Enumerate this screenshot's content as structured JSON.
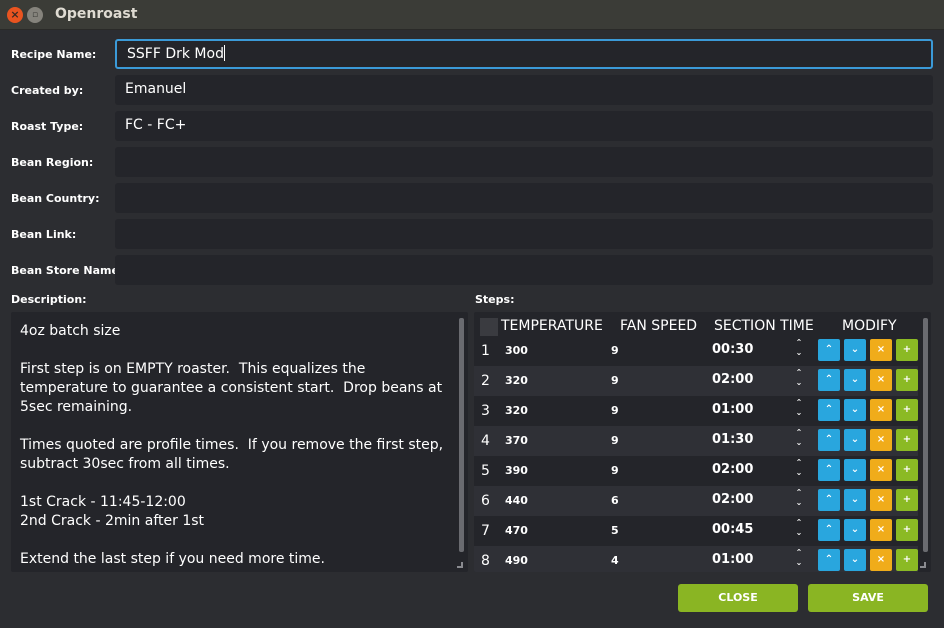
{
  "window": {
    "title": "Openroast",
    "close_glyph": "×",
    "max_glyph": "▫"
  },
  "form": {
    "recipe_name": {
      "label": "Recipe Name:",
      "value": "SSFF Drk Mod"
    },
    "created_by": {
      "label": "Created by:",
      "value": "Emanuel"
    },
    "roast_type": {
      "label": "Roast Type:",
      "value": "FC - FC+"
    },
    "bean_region": {
      "label": "Bean Region:",
      "value": ""
    },
    "bean_country": {
      "label": "Bean Country:",
      "value": ""
    },
    "bean_link": {
      "label": "Bean Link:",
      "value": ""
    },
    "bean_store_name": {
      "label": "Bean Store Name:",
      "value": ""
    }
  },
  "description": {
    "label": "Description:",
    "text": "4oz batch size\n\nFirst step is on EMPTY roaster.  This equalizes the temperature to guarantee a consistent start.  Drop beans at 5sec remaining.\n\nTimes quoted are profile times.  If you remove the first step, subtract 30sec from all times.\n\n1st Crack - 11:45-12:00\n2nd Crack - 2min after 1st\n\nExtend the last step if you need more time."
  },
  "steps": {
    "label": "Steps:",
    "columns": {
      "temperature": "TEMPERATURE",
      "fan_speed": "FAN SPEED",
      "section_time": "SECTION TIME",
      "modify": "MODIFY"
    },
    "spin_up": "⌃",
    "spin_down": "⌄",
    "buttons": {
      "up": "⌃",
      "down": "⌄",
      "delete": "×",
      "add": "+"
    },
    "rows": [
      {
        "num": "1",
        "temperature": "300",
        "fan_speed": "9",
        "time": "00:30"
      },
      {
        "num": "2",
        "temperature": "320",
        "fan_speed": "9",
        "time": "02:00"
      },
      {
        "num": "3",
        "temperature": "320",
        "fan_speed": "9",
        "time": "01:00"
      },
      {
        "num": "4",
        "temperature": "370",
        "fan_speed": "9",
        "time": "01:30"
      },
      {
        "num": "5",
        "temperature": "390",
        "fan_speed": "9",
        "time": "02:00"
      },
      {
        "num": "6",
        "temperature": "440",
        "fan_speed": "6",
        "time": "02:00"
      },
      {
        "num": "7",
        "temperature": "470",
        "fan_speed": "5",
        "time": "00:45"
      },
      {
        "num": "8",
        "temperature": "490",
        "fan_speed": "4",
        "time": "01:00"
      }
    ]
  },
  "footer": {
    "close_label": "CLOSE",
    "save_label": "SAVE"
  },
  "colors": {
    "accent_green": "#8ab523",
    "blue": "#29a6de",
    "orange": "#f0ac1a",
    "focus": "#3b9ad8"
  }
}
